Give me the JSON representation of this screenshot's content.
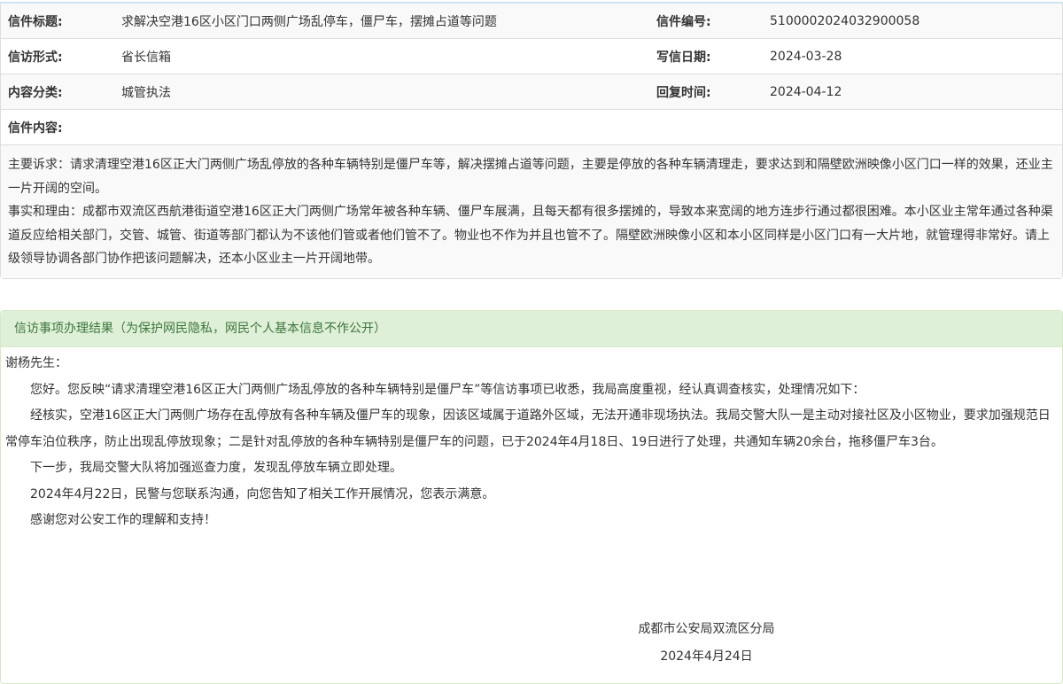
{
  "letter_info": {
    "rows": [
      {
        "label1": "信件标题:",
        "value1": "求解决空港16区小区门口两侧广场乱停车，僵尸车，摆摊占道等问题",
        "label2": "信件编号:",
        "value2": "5100002024032900058"
      },
      {
        "label1": "信访形式:",
        "value1": "省长信箱",
        "label2": "写信日期:",
        "value2": "2024-03-28"
      },
      {
        "label1": "内容分类:",
        "value1": "城管执法",
        "label2": "回复时间:",
        "value2": "2024-04-12"
      }
    ],
    "content_label": "信件内容:",
    "content_paragraphs": [
      "主要诉求：请求清理空港16区正大门两侧广场乱停放的各种车辆特别是僵尸车等，解决摆摊占道等问题，主要是停放的各种车辆清理走，要求达到和隔壁欧洲映像小区门口一样的效果，还业主一片开阔的空间。",
      "事实和理由：成都市双流区西航港街道空港16区正大门两侧广场常年被各种车辆、僵尸车展满，且每天都有很多摆摊的，导致本来宽阔的地方连步行通过都很困难。本小区业主常年通过各种渠道反应给相关部门，交管、城管、街道等部门都认为不该他们管或者他们管不了。物业也不作为并且也管不了。隔壁欧洲映像小区和本小区同样是小区门口有一大片地，就管理得非常好。请上级领导协调各部门协作把该问题解决，还本小区业主一片开阔地带。"
    ]
  },
  "result": {
    "header": "信访事项办理结果（为保护网民隐私，网民个人基本信息不作公开）",
    "salutation": "谢杨先生：",
    "paragraphs": [
      "您好。您反映“请求清理空港16区正大门两侧广场乱停放的各种车辆特别是僵尸车”等信访事项已收悉，我局高度重视，经认真调查核实，处理情况如下：",
      "经核实，空港16区正大门两侧广场存在乱停放有各种车辆及僵尸车的现象，因该区域属于道路外区域，无法开通非现场执法。我局交警大队一是主动对接社区及小区物业，要求加强规范日常停车泊位秩序，防止出现乱停放现象；二是针对乱停放的各种车辆特别是僵尸车的问题，已于2024年4月18日、19日进行了处理，共通知车辆20余台，拖移僵尸车3台。",
      "下一步，我局交警大队将加强巡查力度，发现乱停放车辆立即处理。",
      "2024年4月22日，民警与您联系沟通，向您告知了相关工作开展情况，您表示满意。",
      "感谢您对公安工作的理解和支持！"
    ],
    "signature_org": "成都市公安局双流区分局",
    "signature_date": "2024年4月24日"
  }
}
